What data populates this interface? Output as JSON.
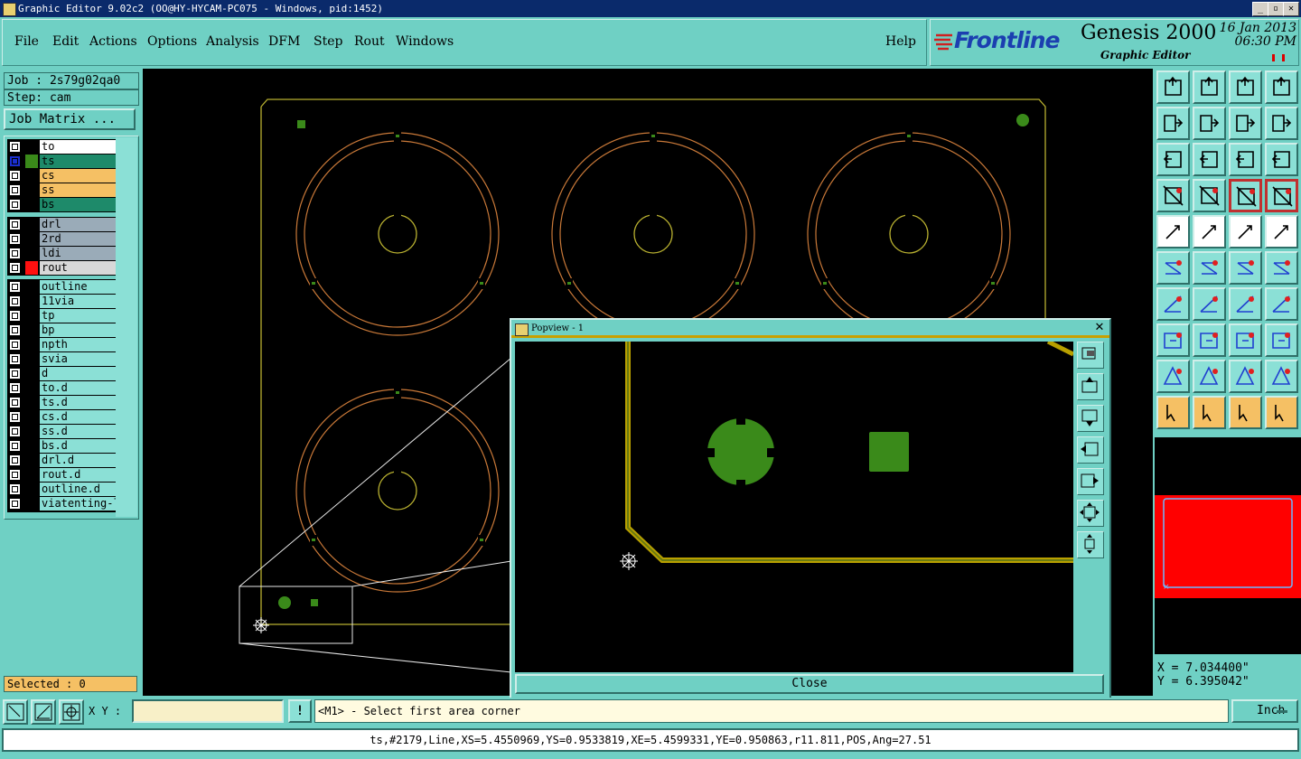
{
  "window": {
    "title": "Graphic Editor 9.02c2 (OO@HY-HYCAM-PC075 - Windows, pid:1452)",
    "controls": [
      "_",
      "▫",
      "✕"
    ]
  },
  "menubar": {
    "items": [
      "File",
      "Edit",
      "Actions",
      "Options",
      "Analysis",
      "DFM",
      "Step",
      "Rout",
      "Windows"
    ],
    "help": "Help"
  },
  "brand": {
    "logo": "Frontline",
    "product": "Genesis 2000",
    "subtitle": "Graphic Editor",
    "date": "16 Jan 2013",
    "time": "06:30 PM"
  },
  "job": {
    "job_label": "Job : 2s79g02qa0",
    "step_label": "Step: cam",
    "matrix_button": "Job Matrix ..."
  },
  "layers": {
    "board": [
      {
        "name": "to",
        "bg": "#ffffff",
        "color": "#000000"
      },
      {
        "name": "ts",
        "bg": "#1e8a6a",
        "color": "#3a8a1a",
        "active": true
      },
      {
        "name": "cs",
        "bg": "#f5c064",
        "color": "#000000"
      },
      {
        "name": "ss",
        "bg": "#f5c064",
        "color": "#000000"
      },
      {
        "name": "bs",
        "bg": "#1e8a6a",
        "color": "#000000"
      }
    ],
    "drill": [
      {
        "name": "drl",
        "bg": "#9aabb8",
        "color": "#000000"
      },
      {
        "name": "2rd",
        "bg": "#9aabb8",
        "color": "#000000"
      },
      {
        "name": "ldi",
        "bg": "#9aabb8",
        "color": "#000000"
      },
      {
        "name": "rout",
        "bg": "#d8d8d8",
        "color": "#ff1010"
      }
    ],
    "misc": [
      "outline",
      "11via",
      "tp",
      "bp",
      "npth",
      "svia",
      "d",
      "to.d",
      "ts.d",
      "cs.d",
      "ss.d",
      "bs.d",
      "drl.d",
      "rout.d",
      "outline.d",
      "viatenting-l"
    ]
  },
  "selected": "Selected : 0",
  "popview": {
    "title": "Popview - 1",
    "close_label": "Close"
  },
  "coords": {
    "x": "X = 7.034400\"",
    "y": "Y = 6.395042\""
  },
  "bottom": {
    "xy_label": "X Y :",
    "xy_value": "",
    "bang": "!",
    "prompt": "<M1> - Select first area corner",
    "unit": "Inch"
  },
  "status": "ts,#2179,Line,XS=5.4550969,YS=0.9533819,XE=5.4599331,YE=0.950863,r11.811,POS,Ang=27.51",
  "colors": {
    "background": "#6fd0c4",
    "canvas": "#000000",
    "outline": "#b8b030",
    "ring": "#c87838",
    "pad": "#3a8a1a",
    "accent_red": "#ff0000"
  }
}
